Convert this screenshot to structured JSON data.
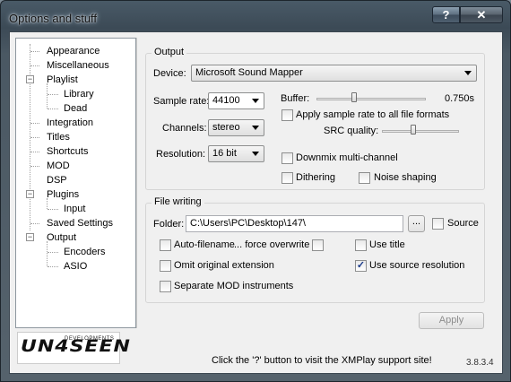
{
  "window": {
    "title": "Options and stuff",
    "help_label": "?",
    "close_label": "✕"
  },
  "tree": {
    "items": [
      {
        "label": "Appearance"
      },
      {
        "label": "Miscellaneous"
      },
      {
        "label": "Playlist",
        "expanded": true
      },
      {
        "label": "Library"
      },
      {
        "label": "Dead"
      },
      {
        "label": "Integration"
      },
      {
        "label": "Titles"
      },
      {
        "label": "Shortcuts"
      },
      {
        "label": "MOD"
      },
      {
        "label": "DSP",
        "expanded": true
      },
      {
        "label": "Plugins",
        "expanded": true
      },
      {
        "label": "Input"
      },
      {
        "label": "Saved Settings"
      },
      {
        "label": "Output",
        "expanded": true,
        "selected": true
      },
      {
        "label": "Encoders"
      },
      {
        "label": "ASIO"
      }
    ]
  },
  "logo": {
    "text": "UN4SEEN",
    "small": "DEVELOPMENTS"
  },
  "output": {
    "group_label": "Output",
    "device_label": "Device:",
    "device_value": "Microsoft Sound Mapper",
    "sample_rate_label": "Sample rate:",
    "sample_rate_value": "44100",
    "buffer_label": "Buffer:",
    "buffer_value": "0.750s",
    "buffer_level": 0.34,
    "apply_rate_label": "Apply sample rate to all file formats",
    "src_quality_label": "SRC quality:",
    "src_quality_level": 0.4,
    "channels_label": "Channels:",
    "channels_value": "stereo",
    "resolution_label": "Resolution:",
    "resolution_value": "16 bit",
    "downmix_label": "Downmix multi-channel",
    "dithering_label": "Dithering",
    "noise_shaping_label": "Noise shaping"
  },
  "file_writing": {
    "group_label": "File writing",
    "folder_label": "Folder:",
    "folder_value": "C:\\Users\\PC\\Desktop\\147\\",
    "browse_label": "...",
    "source_label": "Source",
    "auto_filename_label": "Auto-filename",
    "force_overwrite_label": "... force overwrite",
    "use_title_label": "Use title",
    "omit_extension_label": "Omit original extension",
    "use_source_res_label": "Use source resolution",
    "use_source_res_checked": "✓",
    "separate_mod_label": "Separate MOD instruments"
  },
  "apply_label": "Apply",
  "status_text": "Click the '?' button to visit the XMPlay support site!",
  "version": "3.8.3.4"
}
